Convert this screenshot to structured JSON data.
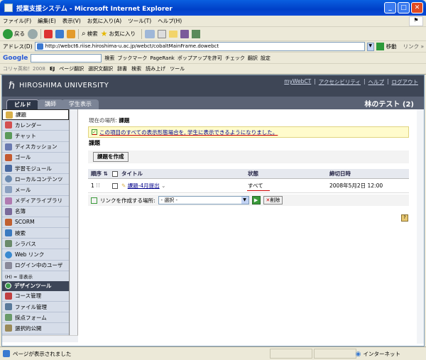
{
  "window": {
    "title": "授業支援システム - Microsoft Internet Explorer"
  },
  "menu": [
    "ファイル(F)",
    "編集(E)",
    "表示(V)",
    "お気に入り(A)",
    "ツール(T)",
    "ヘルプ(H)"
  ],
  "toolbar": {
    "back": "戻る",
    "search": "検索",
    "favorites": "お気に入り"
  },
  "address": {
    "label": "アドレス(D)",
    "url": "http://webct6.riise.hiroshima-u.ac.jp/webct/cobaltMainFrame.dowebct",
    "go": "移動",
    "links": "リンク »"
  },
  "google": {
    "logo": "Google",
    "search": "検索",
    "bookmarks": "ブックマーク",
    "pagerank": "PageRank",
    "popup": "ポップアップを許可",
    "check": "チェック",
    "translate": "翻訳",
    "settings": "設定"
  },
  "extbar": {
    "item0": "コリャ英和！2008",
    "item1": "EJ",
    "item2": "ページ翻訳",
    "item3": "選択文翻訳",
    "item4": "辞書",
    "item5": "検索",
    "item6": "読み上げ",
    "item7": "ツール"
  },
  "header": {
    "university": "HIROSHIMA UNIVERSITY",
    "links": [
      "myWebCT",
      "アクセシビリティ",
      "ヘルプ",
      "ログアウト"
    ],
    "user": "林のテスト (2)"
  },
  "tabs": [
    "ビルド",
    "講師",
    "学生表示"
  ],
  "sidebar": {
    "items": [
      "課題",
      "カレンダー",
      "チャット",
      "ディスカッション",
      "ゴール",
      "学習モジュール",
      "ローカルコンテンツ",
      "メール",
      "メディアライブラリ",
      "名簿",
      "SCORM",
      "検索",
      "シラバス",
      "Web リンク",
      "ログイン中のユーザ"
    ],
    "note": "(H) = 非表示",
    "section": "デザインツール",
    "tools": [
      "コース管理",
      "ファイル管理",
      "採点フォーム",
      "選択的公開"
    ]
  },
  "main": {
    "breadcrumb_label": "現在の場所:",
    "breadcrumb_value": "課題",
    "notice": "この項目のすべての表示形態場合を, 学生に表示できるようになりました。",
    "title": "課題",
    "create_button": "課題を作成",
    "columns": {
      "order": "順序",
      "title": "タイトル",
      "status": "状態",
      "due": "締切日時"
    },
    "rows": [
      {
        "order": "1",
        "title": "課題-4月提出",
        "status": "すべて",
        "due": "2008年5月2日 12:00"
      }
    ],
    "link_label": "リンクを作成する場所:",
    "link_select": "- 選択 -",
    "delete": "削除"
  },
  "statusbar": {
    "text": "ページが表示されました",
    "zone": "インターネット"
  },
  "colors": {
    "title_bar": "#0a5fe0",
    "header_bg": "#3e4656",
    "sidebar_bg": "#d6dde9",
    "notice_bg": "#fffbcc",
    "status_underline": "#cc0000"
  }
}
